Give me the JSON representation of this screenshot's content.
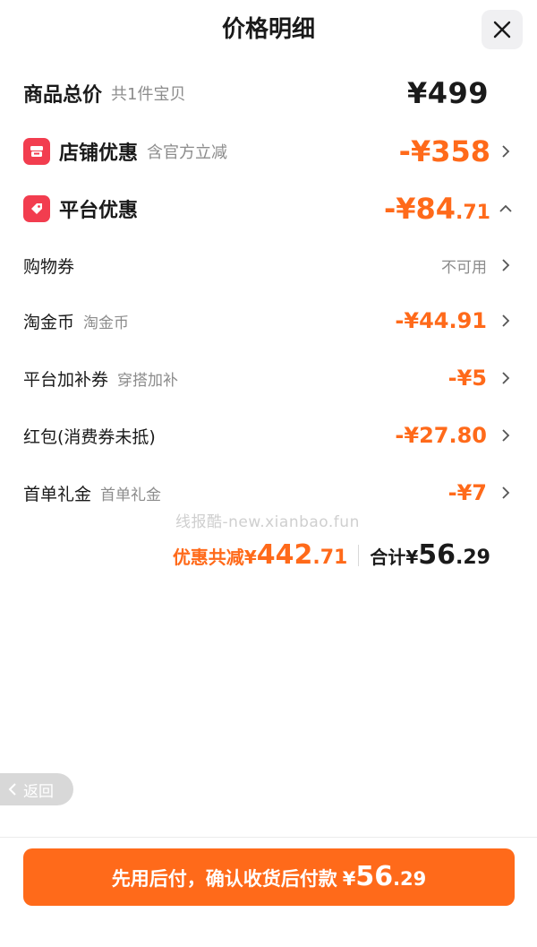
{
  "header": {
    "title": "价格明细",
    "close_icon": "close-icon"
  },
  "total": {
    "label": "商品总价",
    "sub": "共1件宝贝",
    "value": "¥499"
  },
  "shop_discount": {
    "icon": "shop-icon",
    "label": "店铺优惠",
    "sub": "含官方立减",
    "value": "-¥358",
    "chevron": "chevron-right-icon"
  },
  "platform_discount": {
    "icon": "tag-icon",
    "label": "平台优惠",
    "value_int": "-¥84",
    "value_dec": ".71",
    "chevron": "chevron-up-icon"
  },
  "items": [
    {
      "label": "购物券",
      "sub": "",
      "value": "不可用",
      "muted": true
    },
    {
      "label": "淘金币",
      "sub": "淘金币",
      "value": "-¥44.91",
      "muted": false
    },
    {
      "label": "平台加补券",
      "sub": "穿搭加补",
      "value": "-¥5",
      "muted": false
    },
    {
      "label": "红包(消费券未抵)",
      "sub": "",
      "value": "-¥27.80",
      "muted": false
    },
    {
      "label": "首单礼金",
      "sub": "首单礼金",
      "value": "-¥7",
      "muted": false
    }
  ],
  "watermark": "线报酷-new.xianbao.fun",
  "summary": {
    "discount_label": "优惠共减",
    "discount_yen": "¥",
    "discount_int": "442",
    "discount_dec": ".71",
    "total_label": "合计",
    "total_yen": "¥",
    "total_int": "56",
    "total_dec": ".29"
  },
  "back": {
    "label": "返回",
    "icon": "chevron-left-icon"
  },
  "cta": {
    "text": "先用后付，确认收货后付款",
    "yen": "¥",
    "int": "56",
    "dec": ".29"
  },
  "colors": {
    "accent": "#ff6a1a",
    "badge": "#f23d4f",
    "text": "#1a1a1a",
    "muted": "#8c8c8c"
  }
}
